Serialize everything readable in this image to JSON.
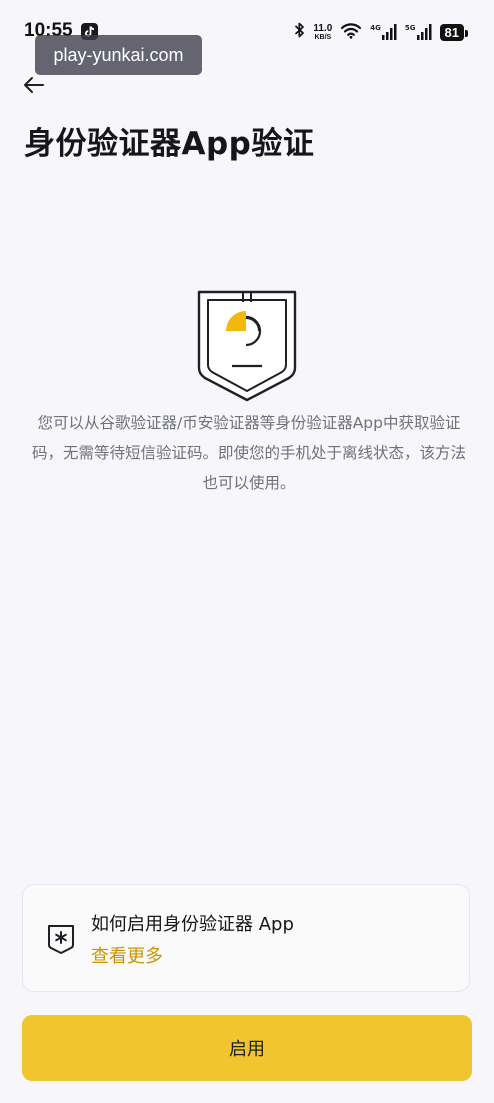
{
  "status_bar": {
    "time": "10:55",
    "net_speed_value": "11.0",
    "net_speed_unit": "KB/S",
    "signal_1_tag": "4G",
    "signal_2_tag": "5G",
    "battery": "81",
    "icons": [
      "tiktok-icon",
      "bluetooth-icon",
      "wifi-icon",
      "signal-icon",
      "battery-icon"
    ]
  },
  "watermark": "play-yunkai.com",
  "header": {
    "back_icon": "arrow-left-icon",
    "title": "身份验证器App验证"
  },
  "illustration": {
    "icon": "shield-icon",
    "accent_color": "#f0b90b"
  },
  "description": "您可以从谷歌验证器/币安验证器等身份验证器App中获取验证码，无需等待短信验证码。即使您的手机处于离线状态，该方法也可以使用。",
  "help_card": {
    "icon": "asterisk-shield-icon",
    "title": "如何启用身份验证器 App",
    "link": "查看更多",
    "link_color": "#c99400"
  },
  "primary_button": {
    "label": "启用",
    "color": "#f0c52d"
  }
}
